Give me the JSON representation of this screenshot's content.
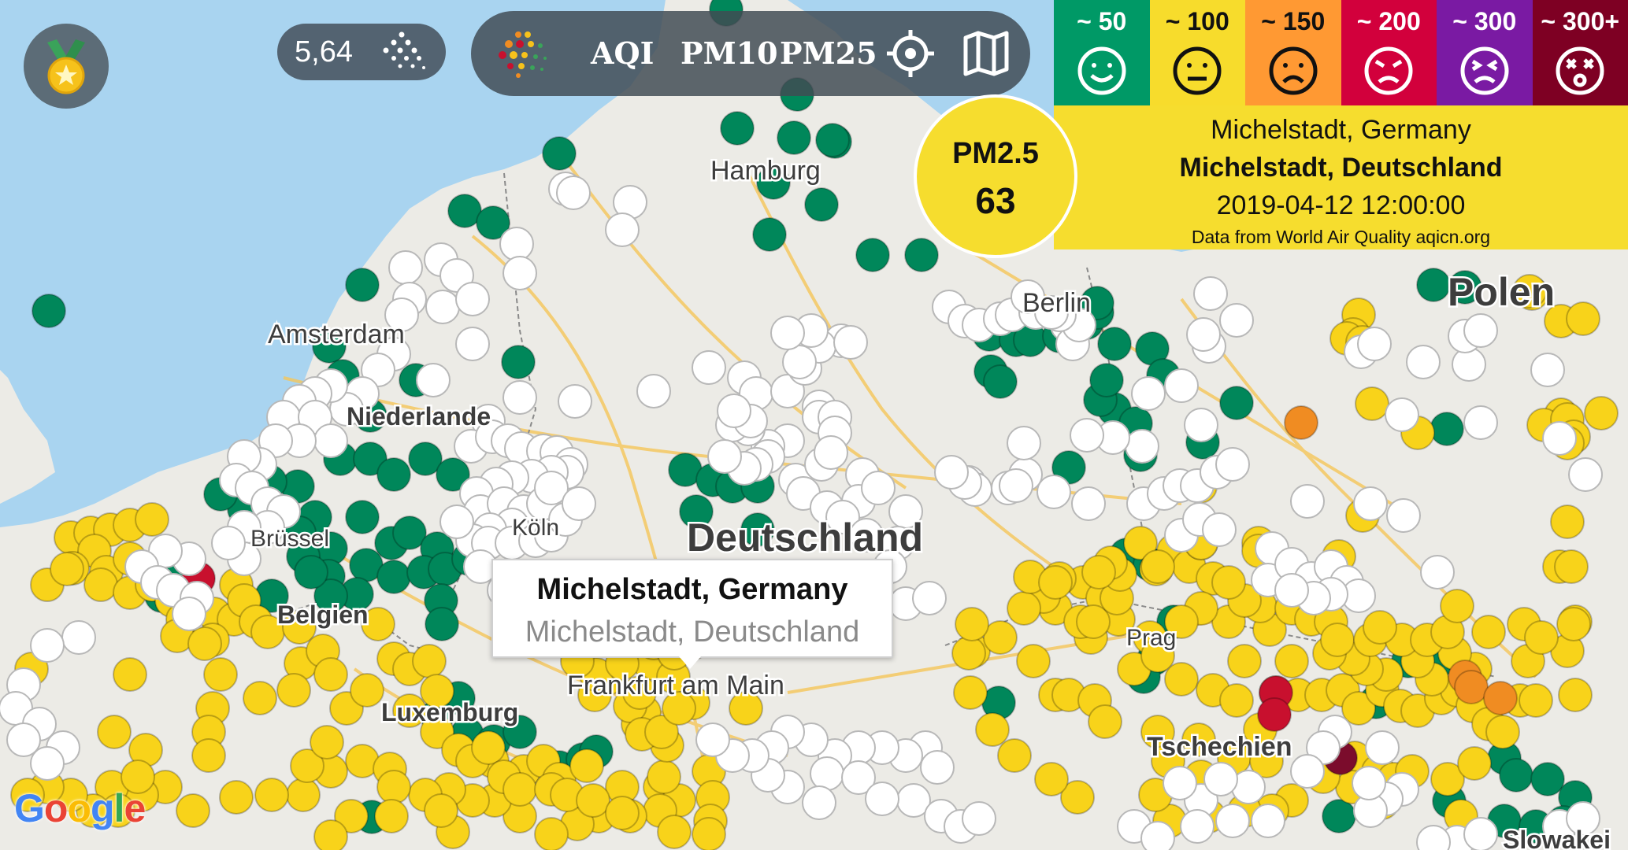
{
  "map": {
    "labels": [
      {
        "id": "hamburg",
        "text": "Hamburg"
      },
      {
        "id": "amsterdam",
        "text": "Amsterdam"
      },
      {
        "id": "niederlande",
        "text": "Niederlande"
      },
      {
        "id": "deutschland",
        "text": "Deutschland"
      },
      {
        "id": "belgien",
        "text": "Belgien"
      },
      {
        "id": "luxemburg",
        "text": "Luxemburg"
      },
      {
        "id": "frankfurt",
        "text": "Frankfurt am Main"
      },
      {
        "id": "berlin",
        "text": "Berlin"
      },
      {
        "id": "polen",
        "text": "Polen"
      },
      {
        "id": "tschechien",
        "text": "Tschechien"
      },
      {
        "id": "slowakei",
        "text": "Slowakei"
      },
      {
        "id": "prag",
        "text": "Prag"
      },
      {
        "id": "koeln",
        "text": "Köln"
      },
      {
        "id": "brussel",
        "text": "Brüssel"
      }
    ],
    "station_colors": {
      "good": "#00875a",
      "moderate": "#f8d31a",
      "sensitive": "#f08c22",
      "unhealthy": "#c8102e",
      "very_unhealthy": "#7b0c2c",
      "no_data": "#ffffff"
    }
  },
  "medal": {
    "icon": "medal-icon"
  },
  "counter": {
    "value": "5,64",
    "icon": "particles-icon"
  },
  "toolbar": {
    "logo_icon": "dots-logo-icon",
    "aqi_label": "AQI",
    "pm10_label": "PM10",
    "pm25_label": "PM25",
    "locate_icon": "crosshair-icon",
    "map_icon": "map-icon"
  },
  "legend": [
    {
      "label": "~ 50",
      "color": "#009966",
      "face": "happy"
    },
    {
      "label": "~ 100",
      "color": "#f7dc2c",
      "face": "neutral"
    },
    {
      "label": "~ 150",
      "color": "#ff9933",
      "face": "sad"
    },
    {
      "label": "~ 200",
      "color": "#d2003c",
      "face": "angry"
    },
    {
      "label": "~ 300",
      "color": "#7a1aa3",
      "face": "dizzy"
    },
    {
      "label": "~ 300+",
      "color": "#7e0023",
      "face": "dead"
    }
  ],
  "info": {
    "name": "Michelstadt, Germany",
    "local_name": "Michelstadt, Deutschland",
    "datetime": "2019-04-12 12:00:00",
    "source": "Data from World Air Quality aqicn.org"
  },
  "badge": {
    "title": "PM2.5",
    "value": "63"
  },
  "popup": {
    "title": "Michelstadt, Germany",
    "subtitle": "Michelstadt, Deutschland"
  },
  "google": {
    "text": "Google"
  }
}
